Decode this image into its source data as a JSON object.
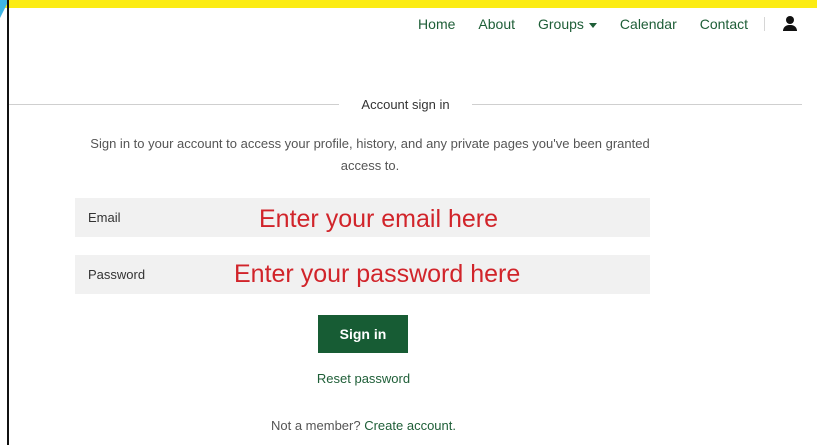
{
  "nav": {
    "items": [
      {
        "label": "Home"
      },
      {
        "label": "About"
      },
      {
        "label": "Groups"
      },
      {
        "label": "Calendar"
      },
      {
        "label": "Contact"
      }
    ]
  },
  "signin": {
    "section_title": "Account sign in",
    "intro": "Sign in to your account to access your profile, history, and any private pages you've been granted access to.",
    "email_label": "Email",
    "email_value": "",
    "password_label": "Password",
    "password_value": "",
    "email_overlay": "Enter your email here",
    "password_overlay": "Enter your password here",
    "submit_label": "Sign in",
    "reset_label": "Reset password",
    "not_member_text": "Not a member?",
    "create_account_label": "Create account."
  },
  "colors": {
    "accent_green": "#175c34",
    "link_green": "#1e5e37",
    "annotation_red": "#d1242a",
    "top_band_yellow": "#fcec13"
  }
}
